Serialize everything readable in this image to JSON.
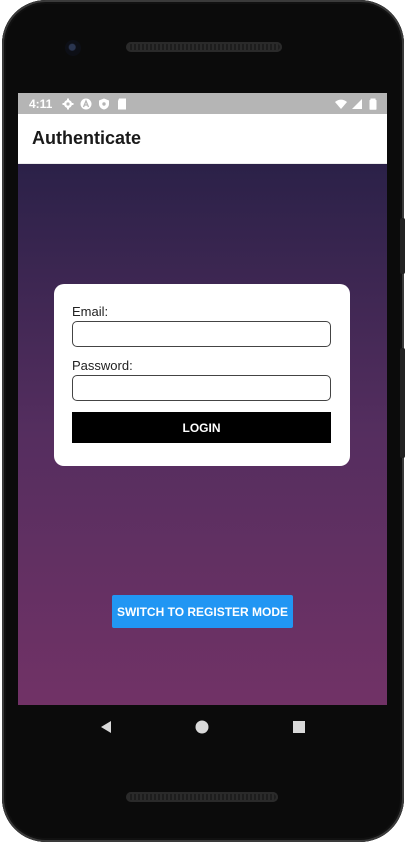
{
  "status_bar": {
    "time": "4:11",
    "left_icons": [
      "gear-icon",
      "a-icon",
      "shield-icon",
      "sd-card-icon"
    ],
    "right_icons": [
      "wifi-icon",
      "signal-icon",
      "battery-icon"
    ]
  },
  "app_bar": {
    "title": "Authenticate"
  },
  "form": {
    "email_label": "Email:",
    "email_value": "",
    "password_label": "Password:",
    "password_value": "",
    "login_label": "LOGIN"
  },
  "switch_label": "SWITCH TO REGISTER MODE",
  "nav": {
    "icons": [
      "back-icon",
      "home-icon",
      "recents-icon"
    ]
  },
  "colors": {
    "gradient_top": "#2b2148",
    "gradient_bottom": "#713266",
    "switch_button": "#2196f3",
    "login_button": "#000000"
  }
}
